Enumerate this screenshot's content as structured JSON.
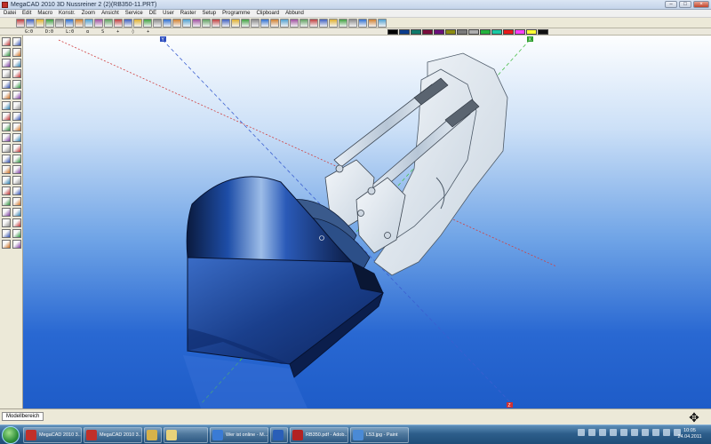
{
  "window": {
    "title": "MegaCAD 2010 3D Nussreiner 2 (2)(RB350-11.PRT)"
  },
  "menu": [
    "Datei",
    "Edit",
    "Macro",
    "Konstr.",
    "Zoom",
    "Ansicht",
    "Service",
    "DE",
    "User",
    "Raster",
    "Setup",
    "Programme",
    "Clipboard",
    "Abbund"
  ],
  "snap": {
    "fields": [
      "G:0",
      "D:0",
      "L:0",
      "α",
      "S",
      "+",
      "◊",
      "+"
    ]
  },
  "palette": {
    "colors": [
      "#000000",
      "#0b3c8c",
      "#0f7a6b",
      "#7a0c3a",
      "#6b0f7a",
      "#8c8c10",
      "#7a7a7a",
      "#aeaeae",
      "#24b33d",
      "#19c9a3",
      "#e81a1a",
      "#ff40ff",
      "#ffff33",
      "#111111"
    ]
  },
  "viewport": {
    "axis_label_top": "Y",
    "axis_label_right": "X",
    "axis_label_bottom": "Z"
  },
  "status": {
    "tab_label": "Modellbereich",
    "nav_icon": "move-arrows-icon"
  },
  "taskbar": {
    "items": [
      {
        "label": "MegaCAD 2010 3...",
        "color": "#c0302a"
      },
      {
        "label": "MegaCAD 2010 3...",
        "color": "#c0302a"
      },
      {
        "label": "",
        "color": "#d6b24a"
      },
      {
        "label": "",
        "color": "#e8d27a"
      },
      {
        "label": "Wer ist online - M...",
        "color": "#3a7bd5"
      },
      {
        "label": "",
        "color": "#2a5fb8"
      },
      {
        "label": "RB350.pdf - Adob...",
        "color": "#b22222"
      },
      {
        "label": "L53.jpg - Paint",
        "color": "#4a8ad6"
      }
    ],
    "clock_time": "10:05",
    "clock_date": "24.04.2011"
  }
}
